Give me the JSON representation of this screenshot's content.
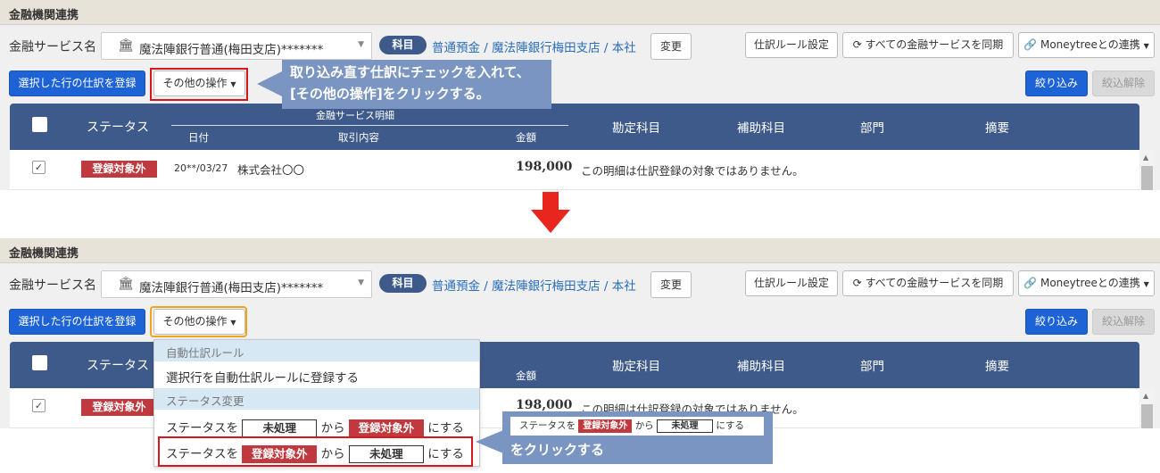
{
  "section_title": "金融機関連携",
  "service": {
    "label": "金融サービス名",
    "selected": "魔法陣銀行普通(梅田支店)*******",
    "icon": "bank-icon"
  },
  "account": {
    "badge": "科目",
    "link": "普通預金 / 魔法陣銀行梅田支店 / 本社",
    "change_label": "変更"
  },
  "toolbar": {
    "rule_settings": "仕訳ルール設定",
    "sync_all": "すべての金融サービスを同期",
    "moneytree": "Moneytreeとの連携",
    "register_selected": "選択した行の仕訳を登録",
    "other_ops": "その他の操作",
    "filter": "絞り込み",
    "clear_filter": "絞込解除"
  },
  "table": {
    "status": "ステータス",
    "group": "金融サービス明細",
    "date": "日付",
    "description": "取引内容",
    "amount": "金額",
    "account": "勘定科目",
    "sub_account": "補助科目",
    "department": "部門",
    "memo": "摘要"
  },
  "row": {
    "status": "登録対象外",
    "date": "20**/03/27",
    "name": "株式会社〇〇",
    "amount": "198,000",
    "note": "この明細は仕訳登録の対象ではありません。"
  },
  "callout_top": {
    "line1": "取り込み直す仕訳にチェックを入れて、",
    "line2": "[その他の操作]をクリックする。"
  },
  "dropdown": {
    "section_auto_rule": "自動仕訳ルール",
    "register_auto_rule": "選択行を自動仕訳ルールに登録する",
    "section_status": "ステータス変更",
    "item1": {
      "prefix": "ステータスを",
      "from": "未処理",
      "mid": "から",
      "to": "登録対象外",
      "suffix": "にする"
    },
    "item2": {
      "prefix": "ステータスを",
      "from": "登録対象外",
      "mid": "から",
      "to": "未処理",
      "suffix": "にする"
    }
  },
  "callout_bottom": {
    "prefix": "ステータスを",
    "from": "登録対象外",
    "mid": "から",
    "to": "未処理",
    "suffix": "にする",
    "text": "をクリックする"
  },
  "colors": {
    "header_blue": "#3e5a8a",
    "button_blue": "#1e63d6",
    "badge_red": "#c0393e",
    "callout": "#7b95c3",
    "highlight_red": "#d9161c",
    "highlight_orange": "#f0a51e"
  }
}
